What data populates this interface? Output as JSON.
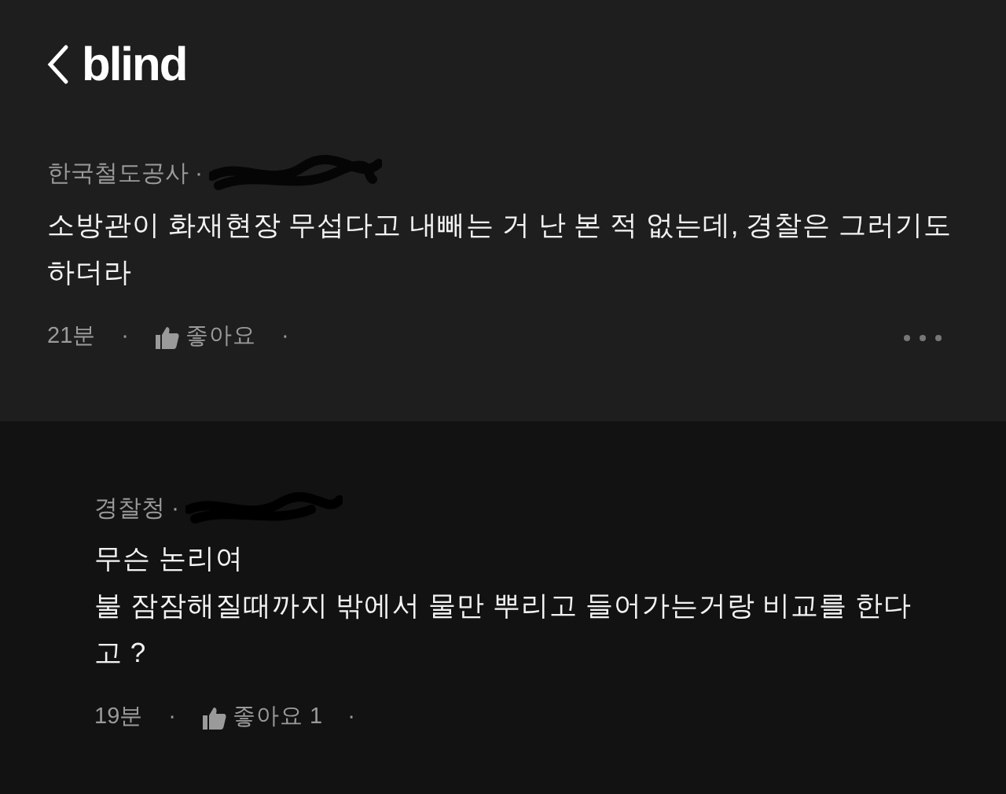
{
  "header": {
    "logo": "blind"
  },
  "post": {
    "company": "한국철도공사",
    "separator": "·",
    "text": "소방관이 화재현장 무섭다고 내빼는 거 난 본 적 없는데, 경찰은 그러기도 하더라",
    "time": "21분",
    "like_label": "좋아요",
    "dot": "·"
  },
  "reply": {
    "company": "경찰청",
    "separator": "·",
    "lines": [
      "무슨 논리여",
      "불 잠잠해질때까지 밖에서 물만 뿌리고 들어가는거랑 비교를 한다고 ?"
    ],
    "time": "19분",
    "like_label": "좋아요",
    "like_count": "1",
    "dot": "·"
  }
}
